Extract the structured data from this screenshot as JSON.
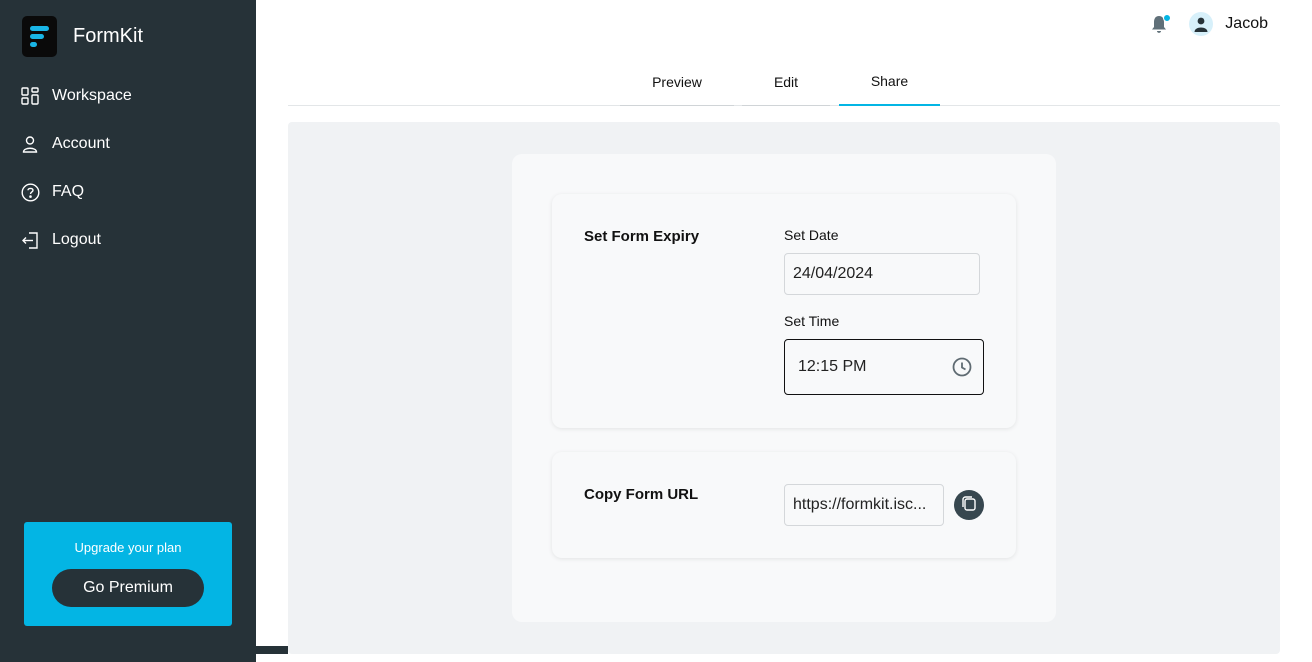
{
  "brand": {
    "name": "FormKit",
    "accent": "#19b5e6"
  },
  "sidebar": {
    "bg": "#263238",
    "items": [
      {
        "label": "Workspace",
        "icon": "grid-icon"
      },
      {
        "label": "Account",
        "icon": "user-icon"
      },
      {
        "label": "FAQ",
        "icon": "help-circle-icon"
      },
      {
        "label": "Logout",
        "icon": "logout-icon"
      }
    ],
    "upgrade": {
      "text": "Upgrade your plan",
      "button_label": "Go Premium",
      "bg": "#03b5e4"
    }
  },
  "header": {
    "user_name": "Jacob",
    "notification_icon": "bell-icon",
    "avatar_icon": "user-avatar-icon"
  },
  "tabs": [
    {
      "label": "Preview",
      "active": false
    },
    {
      "label": "Edit",
      "active": false
    },
    {
      "label": "Share",
      "active": true
    }
  ],
  "share": {
    "expiry": {
      "title": "Set Form Expiry",
      "date_label": "Set Date",
      "date_value": "24/04/2024",
      "time_label": "Set Time",
      "time_value": "12:15 PM",
      "time_icon": "clock-icon"
    },
    "url": {
      "title": "Copy Form URL",
      "value": "https://formkit.isc...",
      "copy_icon": "copy-icon"
    }
  }
}
